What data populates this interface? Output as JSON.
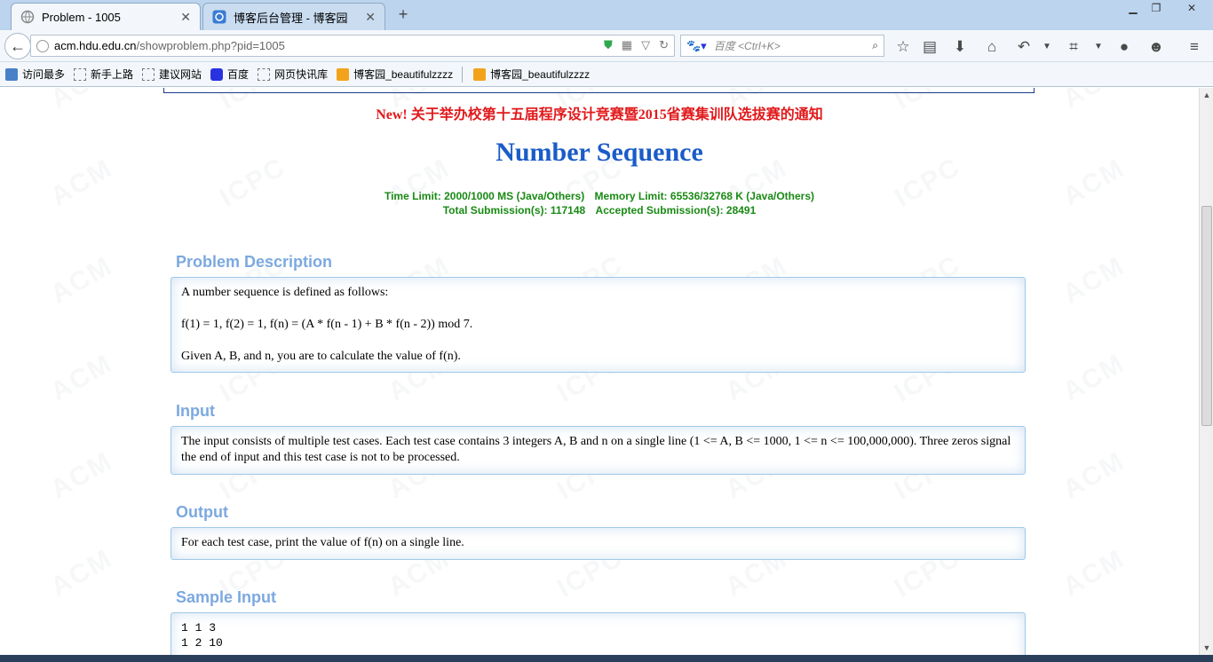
{
  "browser": {
    "tabs": [
      {
        "label": "Problem - 1005",
        "active": true
      },
      {
        "label": "博客后台管理 - 博客园",
        "active": false
      }
    ],
    "new_tab": "+",
    "url_host": "acm.hdu.edu.cn",
    "url_path": "/showproblem.php?pid=1005",
    "search_placeholder": "百度 <Ctrl+K>",
    "bookmarks": [
      {
        "label": "访问最多",
        "icon": "most-visited-icon"
      },
      {
        "label": "新手上路",
        "icon": "page-icon"
      },
      {
        "label": "建议网站",
        "icon": "page-icon"
      },
      {
        "label": "百度",
        "icon": "baidu-paw-icon"
      },
      {
        "label": "网页快讯库",
        "icon": "page-icon"
      },
      {
        "label": "博客园_beautifulzzzz",
        "icon": "rss-icon"
      },
      {
        "label": "博客园_beautifulzzzz",
        "icon": "rss-icon"
      }
    ]
  },
  "problem": {
    "notice": "New! 关于举办校第十五届程序设计竞赛暨2015省赛集训队选拔赛的通知",
    "title": "Number Sequence",
    "time_limit": "Time Limit: 2000/1000 MS (Java/Others)",
    "memory_limit": "Memory Limit: 65536/32768 K (Java/Others)",
    "total_submissions": "Total Submission(s): 117148",
    "accepted_submissions": "Accepted Submission(s): 28491",
    "description_heading": "Problem Description",
    "description": [
      "A number sequence is defined as follows:",
      "f(1) = 1, f(2) = 1, f(n) = (A * f(n - 1) + B * f(n - 2)) mod 7.",
      "Given A, B, and n, you are to calculate the value of f(n)."
    ],
    "input_heading": "Input",
    "input_text": "The input consists of multiple test cases. Each test case contains 3 integers A, B and n on a single line (1 <= A, B <= 1000, 1 <= n <= 100,000,000). Three zeros signal the end of input and this test case is not to be processed.",
    "output_heading": "Output",
    "output_text": "For each test case, print the value of f(n) on a single line.",
    "sample_input_heading": "Sample Input",
    "sample_input": [
      "1 1 3",
      "1 2 10"
    ]
  },
  "watermark_text": "ACM ICPC"
}
